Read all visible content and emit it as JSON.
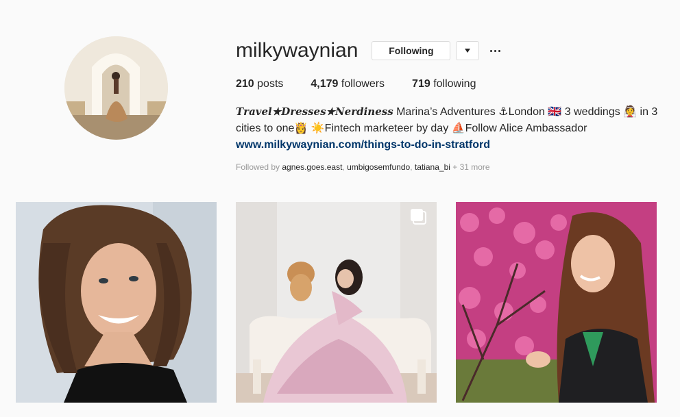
{
  "profile": {
    "username": "milkywaynian",
    "following_button_label": "Following",
    "stats": {
      "posts_count": "210",
      "posts_label": "posts",
      "followers_count": "4,179",
      "followers_label": "followers",
      "following_count": "719",
      "following_label": "following"
    },
    "bio": {
      "styled_text": "𝑻𝒓𝒂𝒗𝒆𝒍★𝑫𝒓𝒆𝒔𝒔𝒆𝒔★𝑵𝒆𝒓𝒅𝒊𝒏𝒆𝒔𝒔",
      "line1_rest": " Marina’s Adventures ⚓London 🇬🇧 3 weddings 👰 in 3 cities to one👸 ☀️Fintech marketeer by day ⛵Follow Alice Ambassador",
      "link": "www.milkywaynian.com/things-to-do-in-stratford"
    },
    "followed_by": {
      "prefix": "Followed by ",
      "account1": "agnes.goes.east",
      "sep1": ", ",
      "account2": "umbigosemfundo",
      "sep2": ", ",
      "account3": "tatiana_bi",
      "suffix": " + 31 more"
    }
  },
  "posts": [
    {
      "icon": "none"
    },
    {
      "icon": "multi-photo-icon"
    },
    {
      "icon": "none"
    }
  ],
  "colors": {
    "background": "#fafafa",
    "text": "#262626",
    "link": "#003569",
    "muted": "#999999",
    "border": "#dbdbdb"
  }
}
